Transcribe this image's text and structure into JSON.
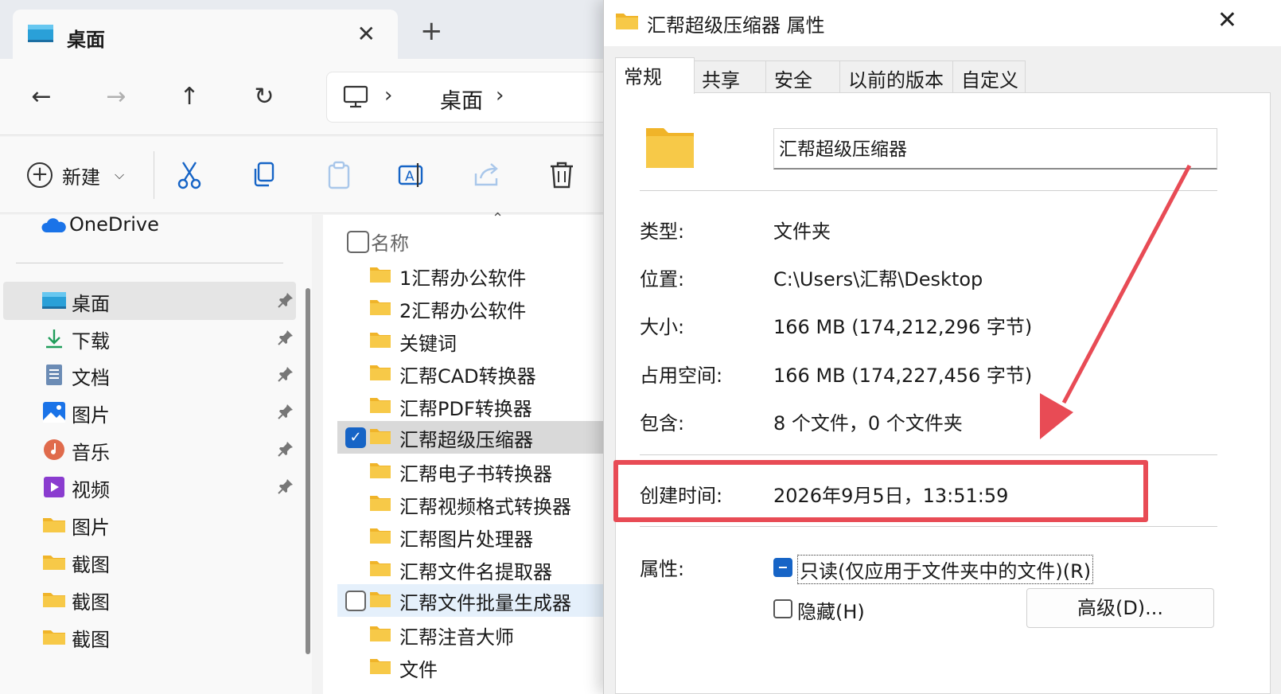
{
  "explorer": {
    "tab_title": "桌面",
    "address_segment": "桌面",
    "toolbar_new_label": "新建",
    "sidebar": {
      "onedrive": "OneDrive",
      "items": [
        {
          "label": "桌面",
          "icon": "desktop-icon",
          "pinned": true,
          "selected": true
        },
        {
          "label": "下载",
          "icon": "download-icon",
          "pinned": true
        },
        {
          "label": "文档",
          "icon": "documents-icon",
          "pinned": true
        },
        {
          "label": "图片",
          "icon": "pictures-icon",
          "pinned": true
        },
        {
          "label": "音乐",
          "icon": "music-icon",
          "pinned": true
        },
        {
          "label": "视频",
          "icon": "videos-icon",
          "pinned": true
        },
        {
          "label": "图片",
          "icon": "folder-icon"
        },
        {
          "label": "截图",
          "icon": "folder-icon"
        },
        {
          "label": "截图",
          "icon": "folder-icon"
        },
        {
          "label": "截图",
          "icon": "folder-icon"
        }
      ]
    },
    "column_header": "名称",
    "files": [
      {
        "name": "1汇帮办公软件"
      },
      {
        "name": "2汇帮办公软件"
      },
      {
        "name": "关键词"
      },
      {
        "name": "汇帮CAD转换器"
      },
      {
        "name": "汇帮PDF转换器"
      },
      {
        "name": "汇帮超级压缩器",
        "selected": true,
        "checked": true
      },
      {
        "name": "汇帮电子书转换器"
      },
      {
        "name": "汇帮视频格式转换器"
      },
      {
        "name": "汇帮图片处理器"
      },
      {
        "name": "汇帮文件名提取器"
      },
      {
        "name": "汇帮文件批量生成器",
        "hover": true
      },
      {
        "name": "汇帮注音大师"
      },
      {
        "name": "文件"
      }
    ]
  },
  "dialog": {
    "title": "汇帮超级压缩器 属性",
    "tabs": [
      "常规",
      "共享",
      "安全",
      "以前的版本",
      "自定义"
    ],
    "folder_name": "汇帮超级压缩器",
    "type_label": "类型:",
    "type_value": "文件夹",
    "location_label": "位置:",
    "location_value": "C:\\Users\\汇帮\\Desktop",
    "size_label": "大小:",
    "size_value": "166 MB (174,212,296 字节)",
    "size_on_disk_label": "占用空间:",
    "size_on_disk_value": "166 MB (174,227,456 字节)",
    "contains_label": "包含:",
    "contains_value": "8 个文件，0 个文件夹",
    "created_label": "创建时间:",
    "created_value": "2026年9月5日，13:51:59",
    "attributes_label": "属性:",
    "readonly_label": "只读(仅应用于文件夹中的文件)(R)",
    "hidden_label": "隐藏(H)",
    "advanced_label": "高级(D)..."
  },
  "colors": {
    "highlight": "#e84b55",
    "accent": "#1664c6",
    "folder": "#f7c948"
  }
}
